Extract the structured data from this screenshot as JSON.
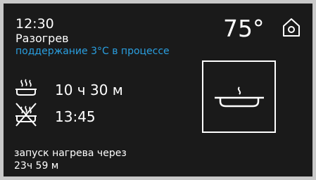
{
  "status": {
    "time": "12:30",
    "mode": "Разогрев",
    "hold_message": "поддержание 3°C в процессе"
  },
  "temperature": {
    "value": "75°"
  },
  "cooking": {
    "duration": "10 ч 30 м",
    "end_time": "13:45"
  },
  "delay": {
    "line1": "запуск нагрева через",
    "line2": "23ч 59 м"
  },
  "icons": {
    "home": "home-icon",
    "cook_duration": "steaming-pan-icon",
    "end_time": "crossed-steaming-pan-icon",
    "preview": "steaming-pan-icon"
  },
  "colors": {
    "background": "#1a1a1a",
    "text": "#ffffff",
    "accent": "#2a9fe0"
  }
}
